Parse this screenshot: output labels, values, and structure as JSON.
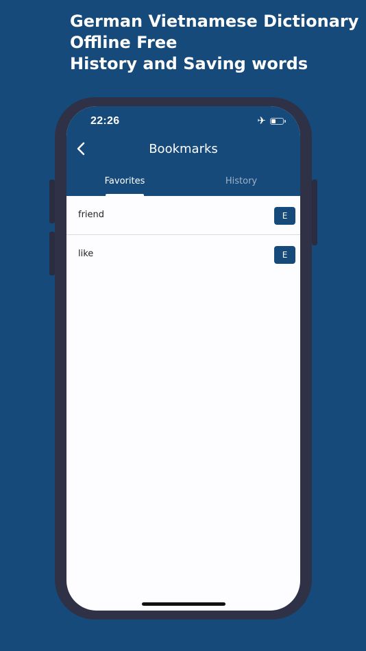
{
  "promo": {
    "line1": "German Vietnamese Dictionary",
    "line2": "Offline Free",
    "line3": "History and Saving words"
  },
  "status_bar": {
    "time": "22:26",
    "airplane_icon": "airplane-icon",
    "battery_icon": "battery-icon"
  },
  "nav": {
    "back_icon": "chevron-left-icon",
    "title": "Bookmarks"
  },
  "tabs": [
    {
      "label": "Favorites",
      "active": true
    },
    {
      "label": "History",
      "active": false
    }
  ],
  "favorites": [
    {
      "word": "friend",
      "badge": "E"
    },
    {
      "word": "like",
      "badge": "E"
    }
  ],
  "colors": {
    "brand": "#154a7a",
    "phone_frame": "#2f3147",
    "screen_bg": "#fdfdff",
    "inactive_tab": "#9fb2c9"
  }
}
